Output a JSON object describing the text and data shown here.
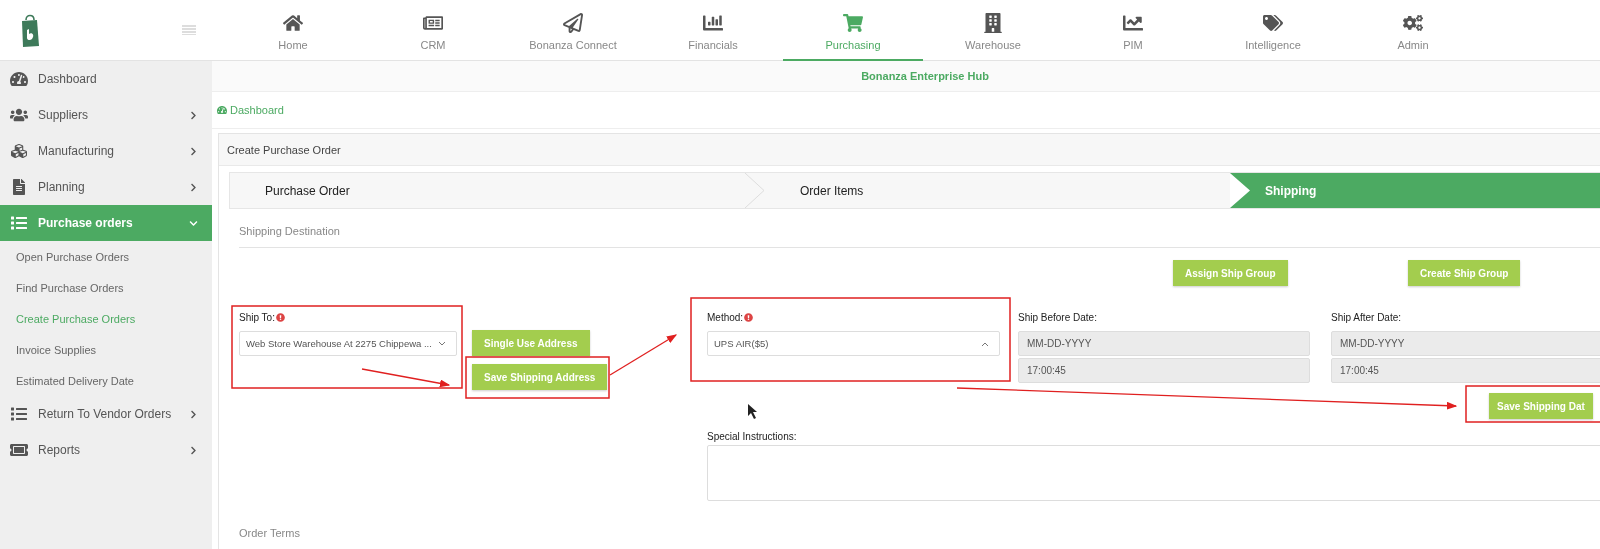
{
  "top_nav": {
    "items": [
      {
        "label": "Home",
        "selected": false
      },
      {
        "label": "CRM",
        "selected": false
      },
      {
        "label": "Bonanza Connect",
        "selected": false
      },
      {
        "label": "Financials",
        "selected": false
      },
      {
        "label": "Purchasing",
        "selected": true
      },
      {
        "label": "Warehouse",
        "selected": false
      },
      {
        "label": "PIM",
        "selected": false
      },
      {
        "label": "Intelligence",
        "selected": false
      },
      {
        "label": "Admin",
        "selected": false
      }
    ]
  },
  "sidebar": {
    "items": [
      {
        "label": "Dashboard",
        "kind": "link",
        "selected": false
      },
      {
        "label": "Suppliers",
        "kind": "group",
        "expanded": false,
        "selected": false
      },
      {
        "label": "Manufacturing",
        "kind": "group",
        "expanded": false,
        "selected": false
      },
      {
        "label": "Planning",
        "kind": "group",
        "expanded": false,
        "selected": false
      },
      {
        "label": "Purchase orders",
        "kind": "group",
        "expanded": true,
        "selected": true,
        "children": [
          {
            "label": "Open Purchase Orders",
            "selected": false
          },
          {
            "label": "Find Purchase Orders",
            "selected": false
          },
          {
            "label": "Create Purchase Orders",
            "selected": true
          },
          {
            "label": "Invoice Supplies",
            "selected": false
          },
          {
            "label": "Estimated Delivery Date",
            "selected": false
          }
        ]
      },
      {
        "label": "Return To Vendor Orders",
        "kind": "group",
        "expanded": false,
        "selected": false
      },
      {
        "label": "Reports",
        "kind": "group",
        "expanded": false,
        "selected": false
      }
    ]
  },
  "hub_title": "Bonanza Enterprise Hub",
  "breadcrumb": "Dashboard",
  "card": {
    "title": "Create Purchase Order",
    "steps": [
      {
        "label": "Purchase Order",
        "selected": false
      },
      {
        "label": "Order Items",
        "selected": false
      },
      {
        "label": "Shipping",
        "selected": true
      }
    ],
    "section_title": "Shipping Destination",
    "group_buttons": [
      "Assign Ship Group",
      "Create Ship Group"
    ],
    "ship_to": {
      "label": "Ship To:",
      "required": true,
      "value": "Web Store Warehouse At 2275 Chippewa ..."
    },
    "address_buttons": [
      "Single Use Address",
      "Save Shipping Address"
    ],
    "method": {
      "label": "Method:",
      "required": true,
      "value": "UPS  AIR($5)"
    },
    "ship_before": {
      "label": "Ship Before Date:",
      "date_placeholder": "MM-DD-YYYY",
      "time": "17:00:45"
    },
    "ship_after": {
      "label": "Ship After Date:",
      "date_placeholder": "MM-DD-YYYY",
      "time": "17:00:45"
    },
    "save_date_button": "Save Shipping Dat",
    "special_instructions": {
      "label": "Special Instructions:"
    },
    "next_section_title": "Order Terms"
  }
}
